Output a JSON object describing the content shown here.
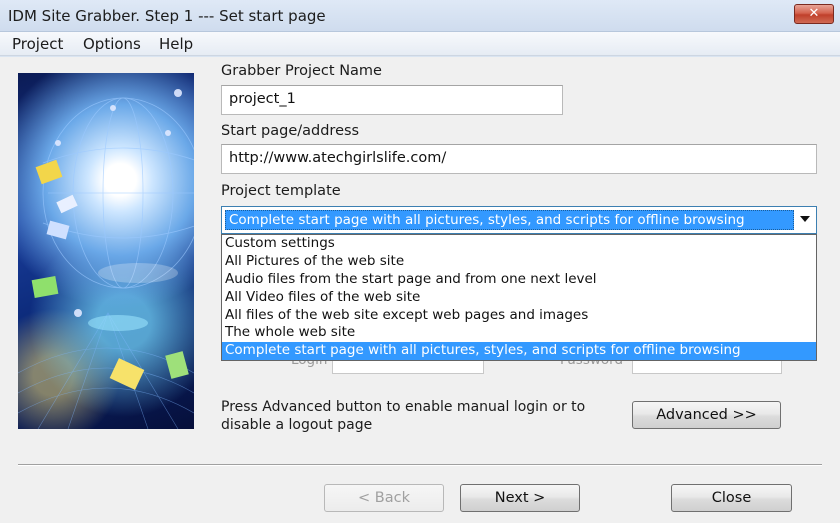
{
  "window": {
    "title": "IDM Site Grabber. Step 1 --- Set start page",
    "close_glyph": "✕"
  },
  "menu": [
    "Project",
    "Options",
    "Help"
  ],
  "form": {
    "project_name_label": "Grabber Project Name",
    "project_name_value": "project_1",
    "start_page_label": "Start page/address",
    "start_page_value": "http://www.atechgirlslife.com/",
    "template_label": "Project template",
    "template_selected": "Complete start page with all pictures, styles, and scripts for offline browsing",
    "template_options": [
      "Custom settings",
      "All Pictures of the web site",
      "Audio files from the start page and from one next level",
      "All Video files of the web site",
      "All files of the web site except web pages and images",
      "The whole web site",
      "Complete start page with all pictures, styles, and scripts for offline browsing"
    ],
    "login_label": "Login",
    "password_label": "Password",
    "advanced_hint": "Press Advanced button to enable manual login or to disable a logout page",
    "advanced_button": "Advanced >>"
  },
  "footer": {
    "back_button": "< Back",
    "next_button": "Next >",
    "close_button": "Close"
  },
  "colors": {
    "selection": "#3399ff",
    "titlebar": "#dfe9f6",
    "close_button": "#c0402b"
  }
}
